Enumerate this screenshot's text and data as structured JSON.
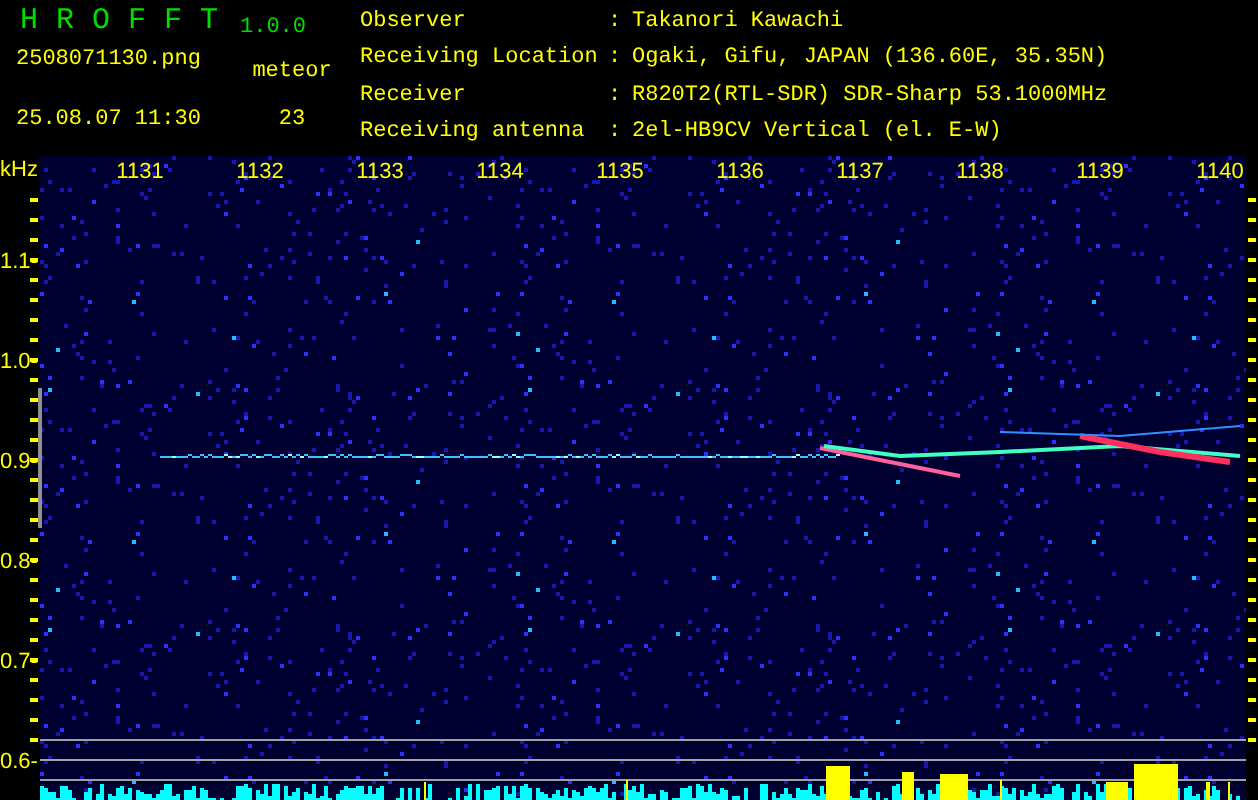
{
  "header": {
    "app_name": "H R O F F T",
    "version": "1.0.0",
    "filename": "2508071130.png",
    "datetime": "25.08.07 11:30",
    "count_label": "meteor",
    "count": "23"
  },
  "station": [
    {
      "label": "Observer",
      "separator": ":",
      "value": "Takanori Kawachi"
    },
    {
      "label": "Receiving Location",
      "separator": ":",
      "value": "Ogaki, Gifu, JAPAN (136.60E, 35.35N)"
    },
    {
      "label": "Receiver",
      "separator": ":",
      "value": "R820T2(RTL-SDR) SDR-Sharp 53.1000MHz"
    },
    {
      "label": "Receiving antenna",
      "separator": ":",
      "value": "2el-HB9CV Vertical (el. E-W)"
    }
  ],
  "spectrogram": {
    "unit": "kHz",
    "x_labels": [
      "1131",
      "1132",
      "1133",
      "1134",
      "1135",
      "1136",
      "1137",
      "1138",
      "1139",
      "1140"
    ],
    "y_labels": [
      "1.1-",
      "1.0-",
      "0.9-",
      "0.8-",
      "0.7-",
      "0.6-"
    ]
  }
}
